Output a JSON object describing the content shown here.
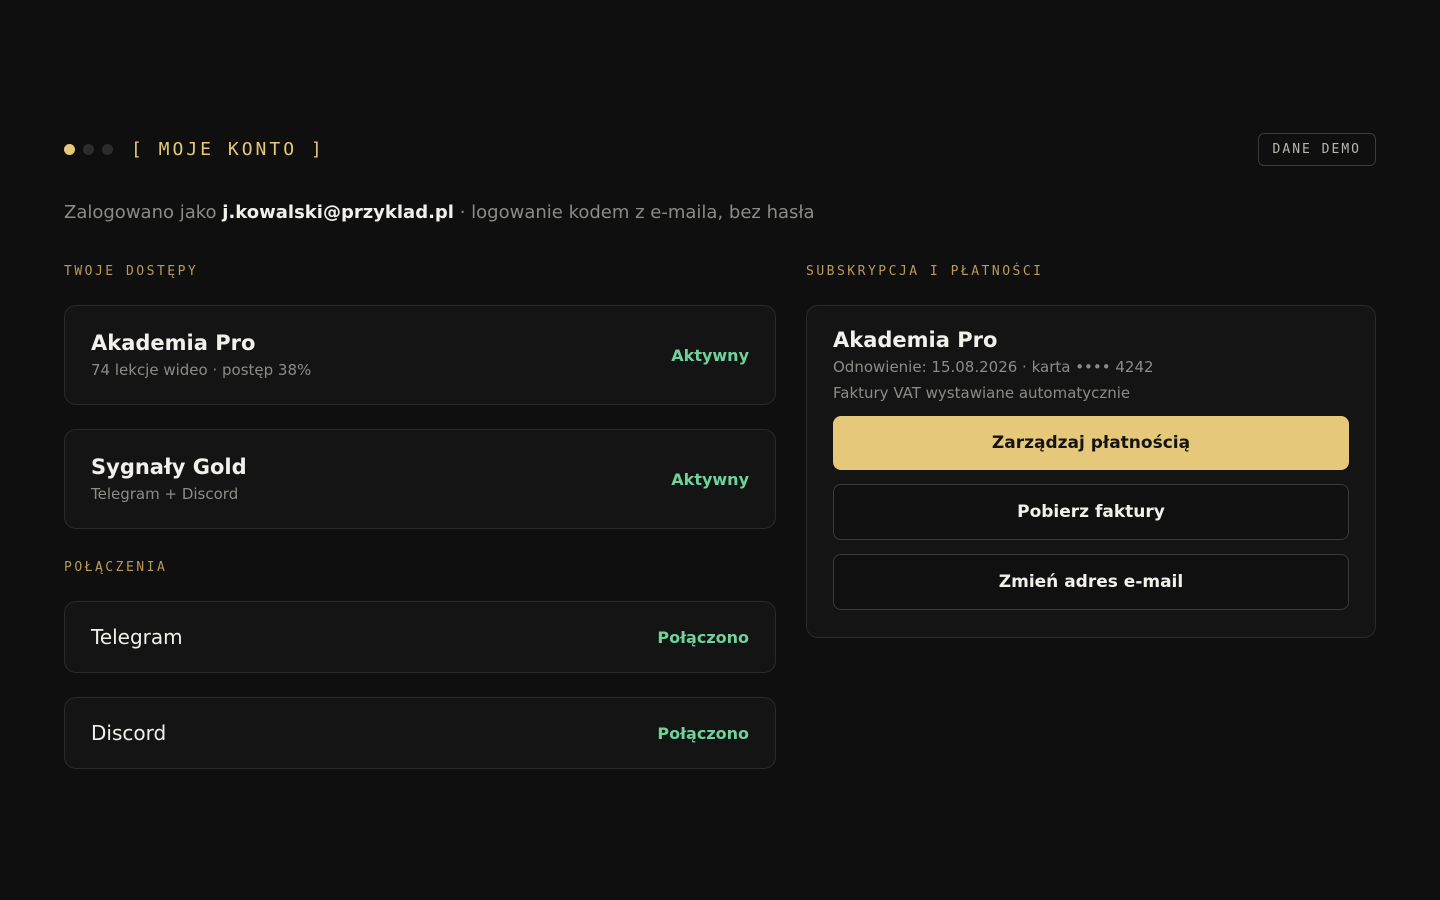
{
  "header": {
    "title": "[ MOJE KONTO ]",
    "badge": "DANE DEMO"
  },
  "login": {
    "prefix": "Zalogowano jako",
    "email": "j.kowalski@przyklad.pl",
    "suffix": "· logowanie kodem z e-maila, bez hasła"
  },
  "access": {
    "section_label": "TWOJE DOSTĘPY",
    "items": [
      {
        "title": "Akademia Pro",
        "subtitle": "74 lekcje wideo · postęp 38%",
        "status": "Aktywny"
      },
      {
        "title": "Sygnały Gold",
        "subtitle": "Telegram + Discord",
        "status": "Aktywny"
      }
    ]
  },
  "connections": {
    "section_label": "POŁĄCZENIA",
    "items": [
      {
        "name": "Telegram",
        "status": "Połączono"
      },
      {
        "name": "Discord",
        "status": "Połączono"
      }
    ]
  },
  "subscription": {
    "section_label": "SUBSKRYPCJA I PŁATNOŚCI",
    "title": "Akademia Pro",
    "renewal": "Odnowienie: 15.08.2026 · karta •••• 4242",
    "invoices_note": "Faktury VAT wystawiane automatycznie",
    "manage_payment_label": "Zarządzaj płatnością",
    "download_invoices_label": "Pobierz faktury",
    "change_email_label": "Zmień adres e-mail"
  },
  "colors": {
    "accent": "#e6c87a",
    "status_green": "#6fd29a",
    "background": "#0f0f0f",
    "card": "#141414"
  }
}
